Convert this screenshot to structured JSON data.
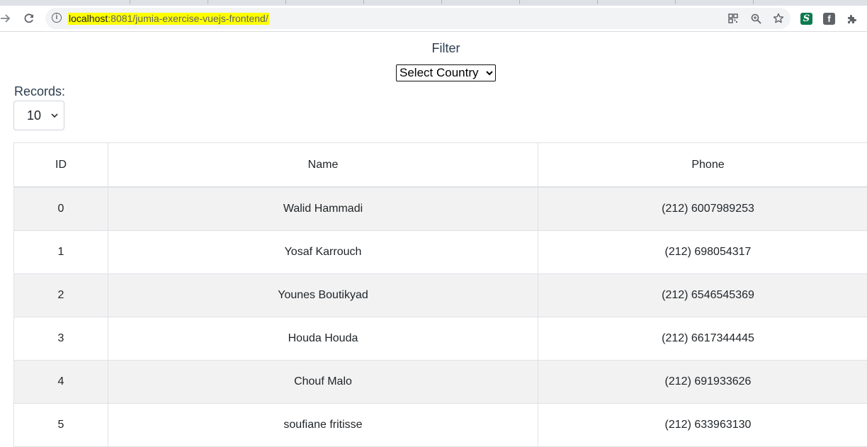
{
  "browser": {
    "url_host": "localhost",
    "url_path": ":8081/jumia-exercise-vuejs-frontend/",
    "icons": {
      "back": "arrow-right-icon",
      "reload": "reload-icon",
      "site_info": "info-icon",
      "qr": "qr-code-icon",
      "zoom": "zoom-icon",
      "bookmark": "star-icon",
      "extension1": "s-extension-icon",
      "extension2": "facebook-extension-icon",
      "extensions": "puzzle-icon"
    }
  },
  "filter": {
    "label": "Filter",
    "country_select_value": "Select Country"
  },
  "records": {
    "label": "Records:",
    "value": "10"
  },
  "table": {
    "headers": [
      "ID",
      "Name",
      "Phone"
    ],
    "rows": [
      {
        "id": "0",
        "name": "Walid Hammadi",
        "phone": "(212) 6007989253"
      },
      {
        "id": "1",
        "name": "Yosaf Karrouch",
        "phone": "(212) 698054317"
      },
      {
        "id": "2",
        "name": "Younes Boutikyad",
        "phone": "(212) 6546545369"
      },
      {
        "id": "3",
        "name": "Houda Houda",
        "phone": "(212) 6617344445"
      },
      {
        "id": "4",
        "name": "Chouf Malo",
        "phone": "(212) 691933626"
      },
      {
        "id": "5",
        "name": "soufiane fritisse",
        "phone": "(212) 633963130"
      }
    ]
  },
  "colors": {
    "url_highlight": "#ffff00",
    "striped_row": "#f2f2f2",
    "border": "#dee2e6",
    "label_text": "#2c3e50"
  }
}
